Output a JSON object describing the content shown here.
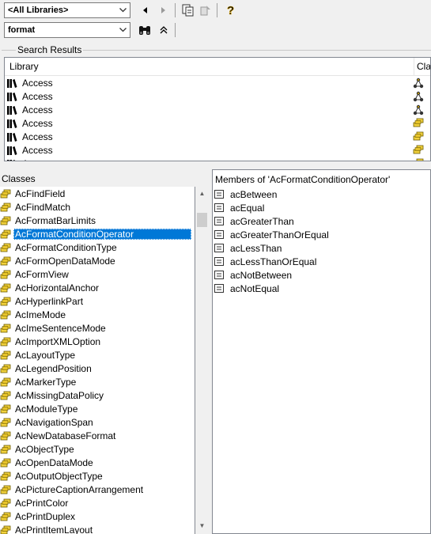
{
  "toolbar": {
    "library_combo": "<All Libraries>",
    "search_combo": "format"
  },
  "search_results": {
    "group_label": "Search Results",
    "col_library": "Library",
    "col_class": "Cla",
    "rows": [
      {
        "library": "Access"
      },
      {
        "library": "Access"
      },
      {
        "library": "Access"
      },
      {
        "library": "Access"
      },
      {
        "library": "Access"
      },
      {
        "library": "Access"
      },
      {
        "library": "Access"
      }
    ]
  },
  "classes": {
    "title": "Classes",
    "items": [
      "AcFindField",
      "AcFindMatch",
      "AcFormatBarLimits",
      "AcFormatConditionOperator",
      "AcFormatConditionType",
      "AcFormOpenDataMode",
      "AcFormView",
      "AcHorizontalAnchor",
      "AcHyperlinkPart",
      "AcImeMode",
      "AcImeSentenceMode",
      "AcImportXMLOption",
      "AcLayoutType",
      "AcLegendPosition",
      "AcMarkerType",
      "AcMissingDataPolicy",
      "AcModuleType",
      "AcNavigationSpan",
      "AcNewDatabaseFormat",
      "AcObjectType",
      "AcOpenDataMode",
      "AcOutputObjectType",
      "AcPictureCaptionArrangement",
      "AcPrintColor",
      "AcPrintDuplex",
      "AcPrintItemLayout"
    ],
    "selected": "AcFormatConditionOperator"
  },
  "members": {
    "title": "Members of 'AcFormatConditionOperator'",
    "items": [
      "acBetween",
      "acEqual",
      "acGreaterThan",
      "acGreaterThanOrEqual",
      "acLessThan",
      "acLessThanOrEqual",
      "acNotBetween",
      "acNotEqual"
    ]
  },
  "icons": [
    "library-icon",
    "enum-icon",
    "module-icon",
    "constant-icon",
    "binoculars-icon",
    "help-icon",
    "copy-icon"
  ]
}
